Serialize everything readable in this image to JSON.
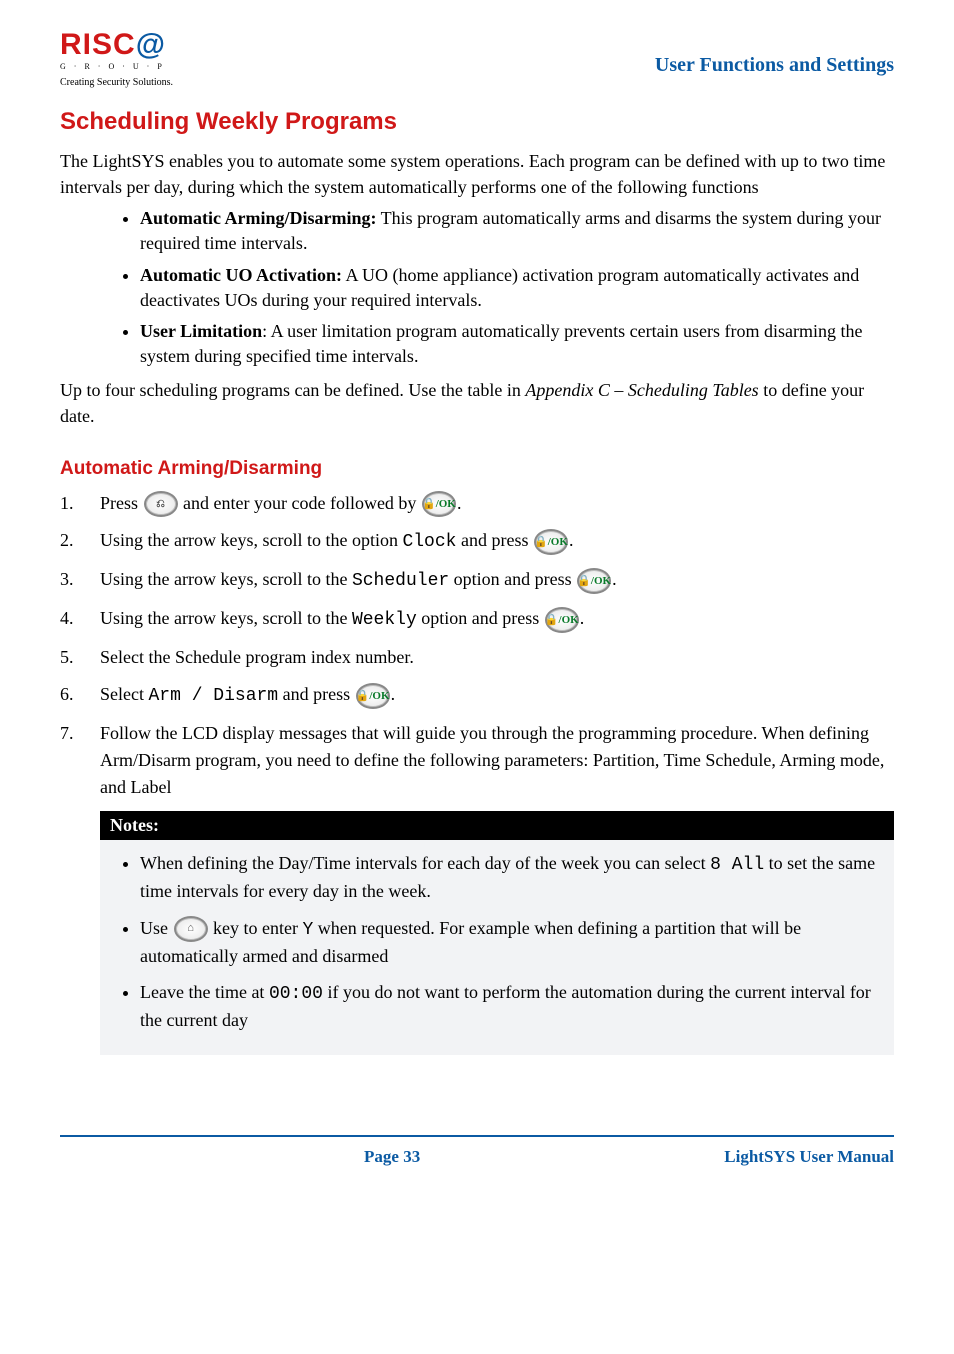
{
  "header": {
    "logo_main_prefix": "RISC",
    "logo_main_at": "@",
    "logo_group": "G · R · O · U · P",
    "logo_tagline": "Creating Security Solutions.",
    "section_title": "User Functions and Settings"
  },
  "h2": "Scheduling Weekly Programs",
  "intro_text": "The LightSYS enables you to automate some system operations. Each program can be defined with up to two time intervals per day, during which the system automatically performs one of the following functions",
  "bullets": [
    {
      "label": "Automatic Arming/Disarming:",
      "text": " This program automatically arms and disarms the system during your required time intervals."
    },
    {
      "label": "Automatic UO Activation:",
      "text": " A UO (home appliance) activation program automatically activates and deactivates UOs during your required intervals."
    },
    {
      "label": "User Limitation",
      "text": ": A user limitation program automatically prevents certain users from disarming the system during specified time intervals."
    }
  ],
  "after_bullets_1": "Up to four scheduling programs can be defined. Use the table in ",
  "after_bullets_italic": "Appendix C – Scheduling Tables",
  "after_bullets_2": " to define your date.",
  "h3": "Automatic Arming/Disarming",
  "steps": {
    "s1a": "Press ",
    "s1b": " and enter your code followed by ",
    "s1c": ".",
    "s2a": "Using the arrow keys, scroll to the option ",
    "s2_code1": "Clock",
    "s2b": " and press ",
    "s2c": ".",
    "s3a": "Using the arrow keys, scroll to the ",
    "s3_code": "Scheduler",
    "s3b": " option and press ",
    "s3c": ".",
    "s4a": "Using the arrow keys, scroll to the ",
    "s4_code": "Weekly",
    "s4b": " option and press ",
    "s4c": ".",
    "s5": "Select the Schedule program index number.",
    "s6a": "Select ",
    "s6_code": "Arm / Disarm",
    "s6b": " and press ",
    "s6c": ".",
    "s7": "Follow the LCD display messages that will guide you through the programming procedure. When defining Arm/Disarm program, you need to define the following parameters: Partition, Time Schedule, Arming mode, and Label"
  },
  "notes_header": "Notes:",
  "notes": {
    "n1a": "When defining the Day/Time intervals for each day of the week you can select ",
    "n1_code": "8 All",
    "n1b": " to set the same time intervals for every day in the week.",
    "n2a": "Use ",
    "n2b": " key to enter ",
    "n2_code": "Y",
    "n2c": " when requested. For example when defining a partition that will be automatically armed and disarmed",
    "n3a": "Leave the time at ",
    "n3_code": "00:00",
    "n3b": "  if you do not want to perform the automation during the current interval for the current day"
  },
  "icons": {
    "back": "⎌",
    "ok": "🔒/OK",
    "stay": "⌂"
  },
  "footer": {
    "page": "Page 33",
    "manual": "LightSYS User Manual"
  }
}
